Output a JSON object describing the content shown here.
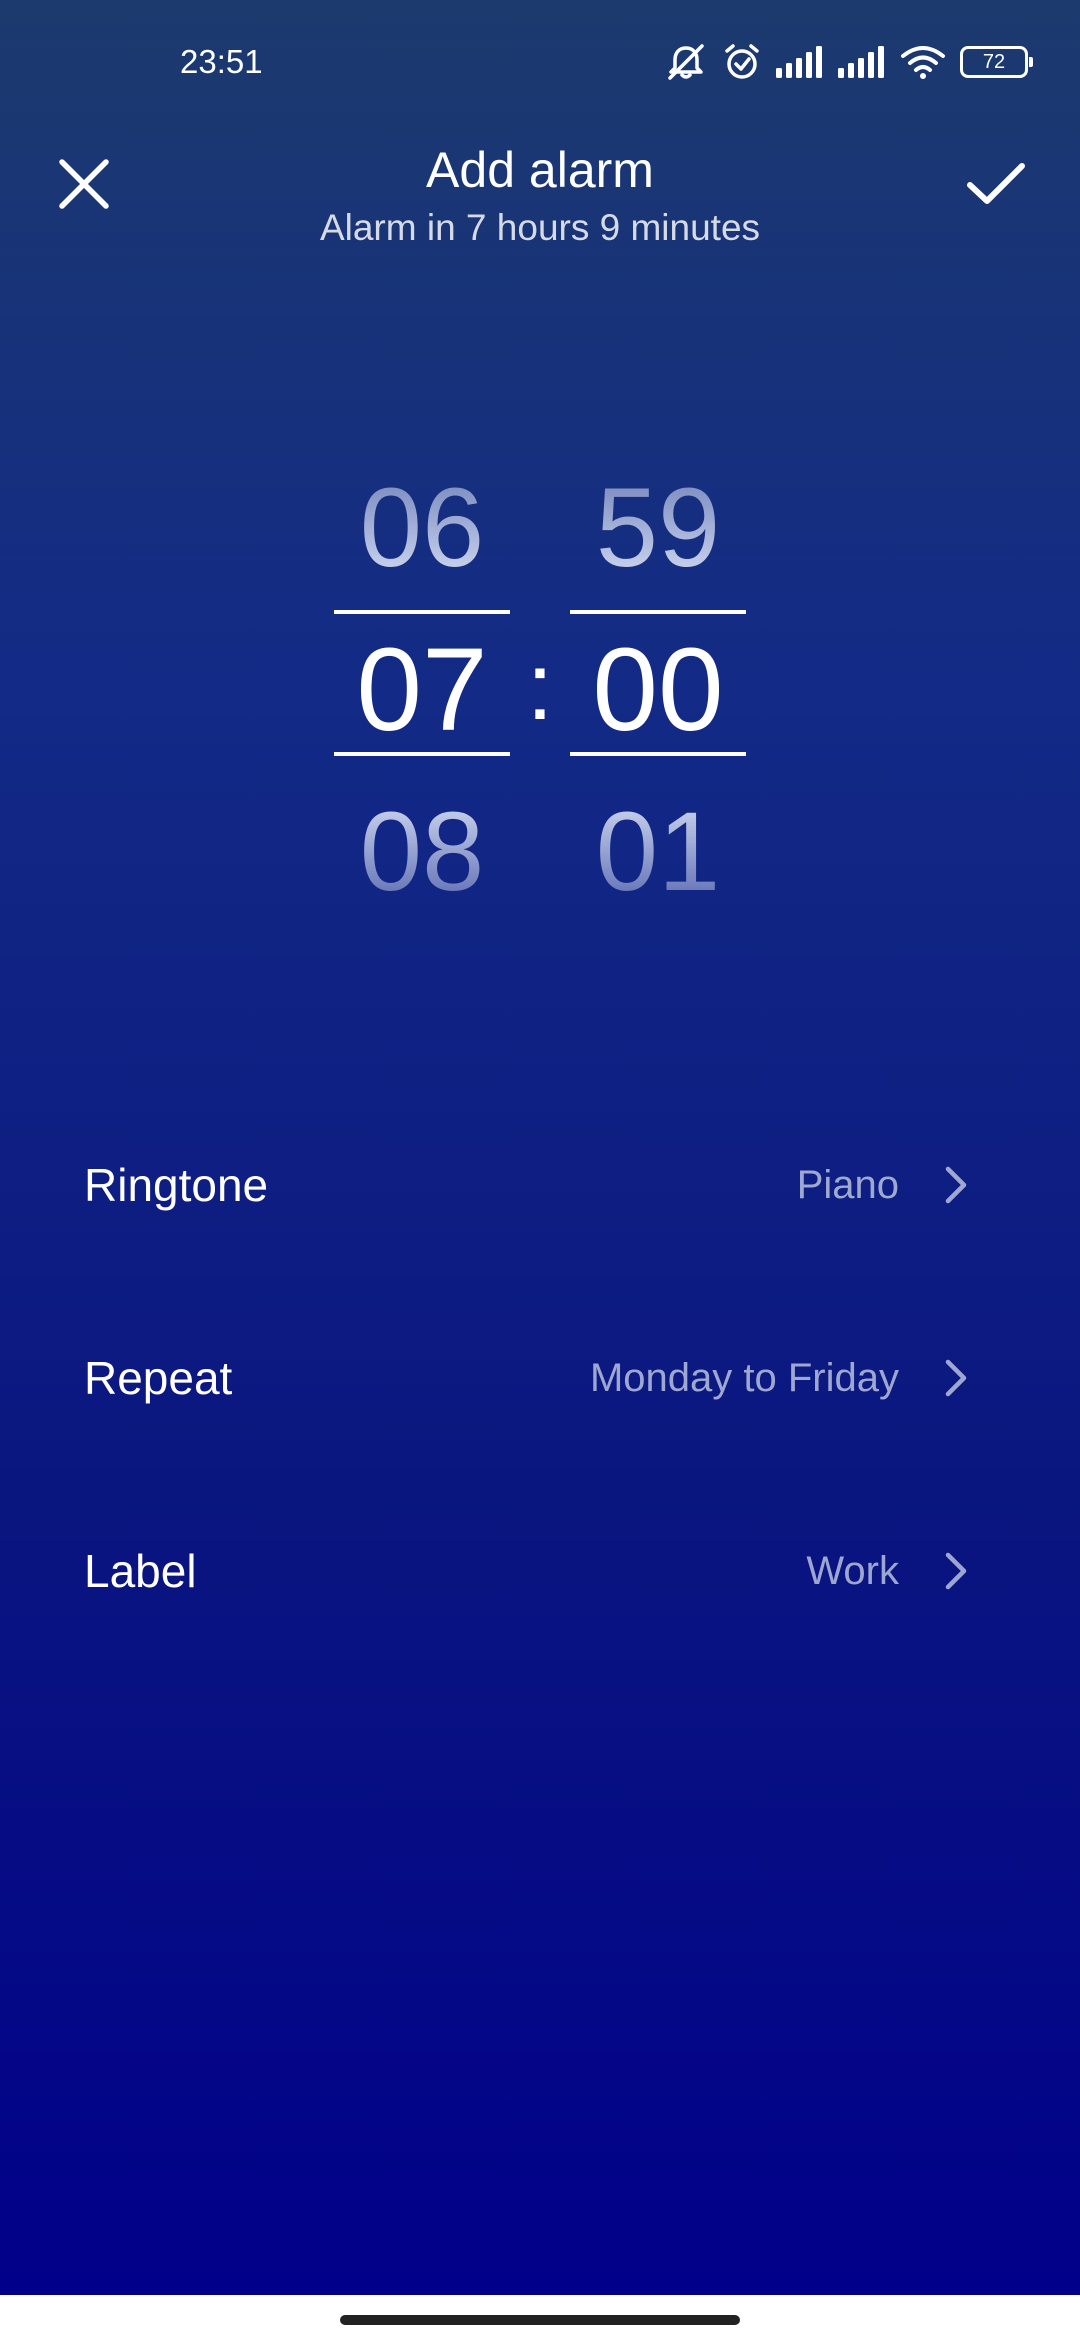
{
  "status_bar": {
    "time": "23:51",
    "battery": "72",
    "icons": [
      "mute-icon",
      "alarm-icon",
      "signal-icon",
      "signal-icon",
      "wifi-icon",
      "battery-icon"
    ]
  },
  "header": {
    "title": "Add alarm",
    "subtitle": "Alarm in 7 hours 9 minutes",
    "close_icon": "close-icon",
    "confirm_icon": "check-icon"
  },
  "time_picker": {
    "hours": {
      "prev": "06",
      "current": "07",
      "next": "08"
    },
    "separator": ":",
    "minutes": {
      "prev": "59",
      "current": "00",
      "next": "01"
    }
  },
  "settings": [
    {
      "label": "Ringtone",
      "value": "Piano"
    },
    {
      "label": "Repeat",
      "value": "Monday to Friday"
    },
    {
      "label": "Label",
      "value": "Work"
    }
  ],
  "colors": {
    "gradient_top": "#1c3a6e",
    "gradient_bottom": "#01008a",
    "text_primary": "#ffffff"
  }
}
